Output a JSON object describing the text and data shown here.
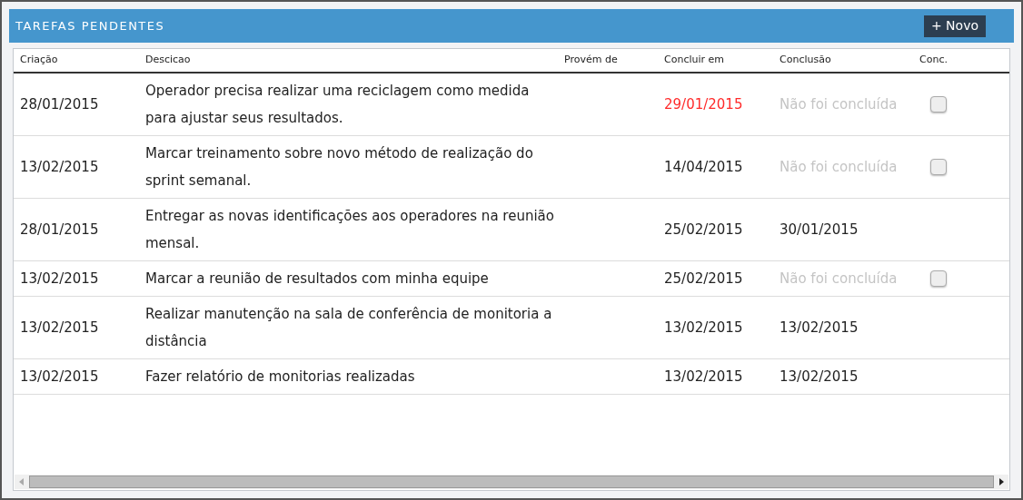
{
  "panel": {
    "title": "TAREFAS PENDENTES",
    "new_button": "+ Novo"
  },
  "table": {
    "columns": [
      "Criação",
      "Descicao",
      "Provém de",
      "Concluir em",
      "Conclusão",
      "Conc."
    ],
    "rows": [
      {
        "created": "28/01/2015",
        "description": "Operador precisa realizar uma reciclagem como medida para ajustar seus resultados.",
        "due": "29/01/2015",
        "overdue": true,
        "conclusion": "Não foi concluída",
        "completed": false,
        "checked": false
      },
      {
        "created": "13/02/2015",
        "description": "Marcar treinamento sobre novo método de realização do sprint semanal.",
        "due": "14/04/2015",
        "overdue": false,
        "conclusion": "Não foi concluída",
        "completed": false,
        "checked": false
      },
      {
        "created": "28/01/2015",
        "description": "Entregar as novas identificações aos operadores na reunião mensal.",
        "due": "25/02/2015",
        "overdue": false,
        "conclusion": "30/01/2015",
        "completed": true
      },
      {
        "created": "13/02/2015",
        "description": "Marcar a reunião de resultados com minha equipe",
        "due": "25/02/2015",
        "overdue": false,
        "conclusion": "Não foi concluída",
        "completed": false,
        "checked": false
      },
      {
        "created": "13/02/2015",
        "description": "Realizar manutenção na sala de conferência de monitoria a distância",
        "due": "13/02/2015",
        "overdue": false,
        "conclusion": "13/02/2015",
        "completed": true
      },
      {
        "created": "13/02/2015",
        "description": "Fazer relatório de monitorias realizadas",
        "due": "13/02/2015",
        "overdue": false,
        "conclusion": "13/02/2015",
        "completed": true
      }
    ]
  }
}
